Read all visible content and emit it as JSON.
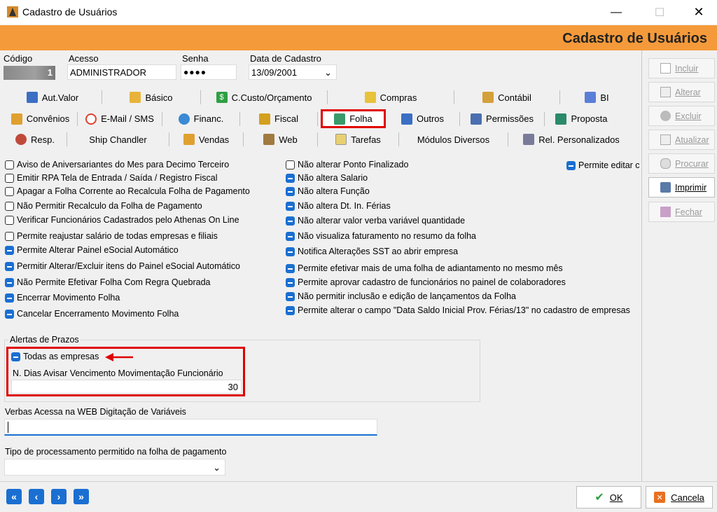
{
  "window": {
    "title": "Cadastro de Usuários",
    "header": "Cadastro de Usuários"
  },
  "fields": {
    "codigo_label": "Código",
    "codigo_value": "1",
    "acesso_label": "Acesso",
    "acesso_value": "ADMINISTRADOR",
    "senha_label": "Senha",
    "senha_value": "●●●●",
    "data_label": "Data de Cadastro",
    "data_value": "13/09/2001"
  },
  "tabs": {
    "row1": [
      "Aut.Valor",
      "Básico",
      "C.Custo/Orçamento",
      "Compras",
      "Contábil",
      "BI"
    ],
    "row2": [
      "Convênios",
      "E-Mail / SMS",
      "Financ.",
      "Fiscal",
      "Folha",
      "Outros",
      "Permissões",
      "Proposta"
    ],
    "row3": [
      "Resp.",
      "Ship Chandler",
      "Vendas",
      "Web",
      "Tarefas",
      "Módulos Diversos",
      "Rel. Personalizados"
    ],
    "active": "Folha"
  },
  "options_left": [
    {
      "label": "Aviso de Aniversariantes do Mes para Decimo Terceiro",
      "checked": false
    },
    {
      "label": "Emitir RPA Tela de Entrada / Saída / Registro Fiscal",
      "checked": false
    },
    {
      "label": "Apagar a Folha Corrente ao Recalcula Folha de Pagamento",
      "checked": false
    },
    {
      "label": "Não Permitir Recalculo da Folha de Pagamento",
      "checked": false
    },
    {
      "label": "Verificar Funcionários Cadastrados pelo Athenas On Line",
      "checked": false
    },
    {
      "label": "Permite reajustar salário de todas empresas e filiais",
      "checked": false
    },
    {
      "label": "Permite Alterar Painel eSocial Automático",
      "checked": true
    },
    {
      "label": "Permitir Alterar/Excluir itens do Painel eSocial Automático",
      "checked": true
    },
    {
      "label": "Não Permite Efetivar Folha Com Regra Quebrada",
      "checked": true
    },
    {
      "label": "Encerrar Movimento Folha",
      "checked": true
    },
    {
      "label": "Cancelar Encerramento Movimento Folha",
      "checked": true
    }
  ],
  "options_mid": [
    {
      "label": "Não alterar Ponto Finalizado",
      "checked": false
    },
    {
      "label": "Não altera Salario",
      "checked": true
    },
    {
      "label": "Não altera Função",
      "checked": true
    },
    {
      "label": "Não altera Dt. In. Férias",
      "checked": true
    },
    {
      "label": "Não alterar valor verba variável quantidade",
      "checked": true
    },
    {
      "label": "Não visualiza faturamento no resumo da folha",
      "checked": true
    },
    {
      "label": "Notifica Alterações SST ao abrir empresa",
      "checked": true
    },
    {
      "label": "Permite efetivar mais de uma folha de adiantamento no mesmo mês",
      "checked": true
    },
    {
      "label": "Permite aprovar cadastro de funcionários no painel de colaboradores",
      "checked": true
    },
    {
      "label": "Não permitir inclusão e edição de lançamentos da Folha",
      "checked": true
    },
    {
      "label": "Permite alterar o campo \"Data Saldo Inicial Prov. Férias/13\" no cadastro de empresas",
      "checked": true
    }
  ],
  "option_right": {
    "label": "Permite editar c",
    "checked": true
  },
  "alertas": {
    "group_label": "Alertas de Prazos",
    "todas_label": "Todas as empresas",
    "dias_label": "N. Dias Avisar Vencimento Movimentação Funcionário",
    "dias_value": "30"
  },
  "verbas_label": "Verbas Acessa na WEB Digitação de Variáveis",
  "tipo_label": "Tipo de processamento permitido na folha de pagamento",
  "side_buttons": [
    "Incluir",
    "Alterar",
    "Excluir",
    "Atualizar",
    "Procurar",
    "Imprimir",
    "Fechar"
  ],
  "bottom": {
    "ok": "OK",
    "cancel": "Cancela"
  },
  "colors": {
    "accent": "#f59a3a",
    "check": "#1a6fd1",
    "highlight": "#e00000"
  }
}
